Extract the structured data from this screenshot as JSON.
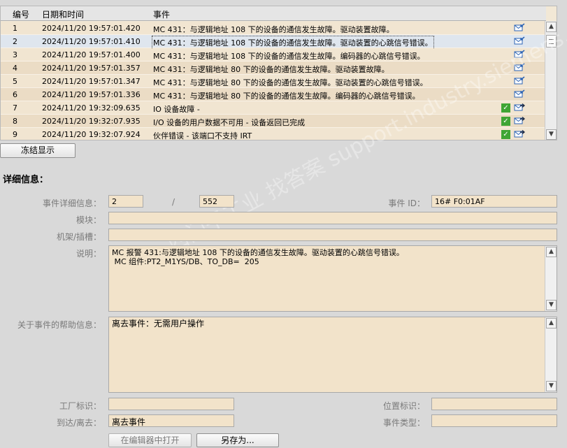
{
  "event_table": {
    "headers": {
      "no": "编号",
      "datetime": "日期和时间",
      "event": "事件"
    },
    "rows": [
      {
        "no": "1",
        "datetime": "2024/11/20 19:57:01.420",
        "event": "MC 431：与逻辑地址 108 下的设备的通信发生故障。驱动装置故障。",
        "ack": false,
        "icon": "incoming-mail-icon"
      },
      {
        "no": "2",
        "datetime": "2024/11/20 19:57:01.410",
        "event": "MC 431：与逻辑地址 108 下的设备的通信发生故障。驱动装置的心跳信号错误。",
        "ack": false,
        "icon": "incoming-mail-icon",
        "selected": true
      },
      {
        "no": "3",
        "datetime": "2024/11/20 19:57:01.400",
        "event": "MC 431：与逻辑地址 108 下的设备的通信发生故障。编码器的心跳信号错误。",
        "ack": false,
        "icon": "incoming-mail-icon"
      },
      {
        "no": "4",
        "datetime": "2024/11/20 19:57:01.357",
        "event": "MC 431：与逻辑地址 80 下的设备的通信发生故障。驱动装置故障。",
        "ack": false,
        "icon": "incoming-mail-icon"
      },
      {
        "no": "5",
        "datetime": "2024/11/20 19:57:01.347",
        "event": "MC 431：与逻辑地址 80 下的设备的通信发生故障。驱动装置的心跳信号错误。",
        "ack": false,
        "icon": "incoming-mail-icon"
      },
      {
        "no": "6",
        "datetime": "2024/11/20 19:57:01.336",
        "event": "MC 431：与逻辑地址 80 下的设备的通信发生故障。编码器的心跳信号错误。",
        "ack": false,
        "icon": "incoming-mail-icon"
      },
      {
        "no": "7",
        "datetime": "2024/11/20 19:32:09.635",
        "event": "IO 设备故障 -",
        "ack": true,
        "icon": "outgoing-mail-icon"
      },
      {
        "no": "8",
        "datetime": "2024/11/20 19:32:07.935",
        "event": "I/O 设备的用户数据不可用 - 设备返回已完成",
        "ack": true,
        "icon": "outgoing-mail-icon"
      },
      {
        "no": "9",
        "datetime": "2024/11/20 19:32:07.924",
        "event": "伙伴错误  - 该端口不支持 IRT",
        "ack": true,
        "icon": "outgoing-mail-icon"
      }
    ]
  },
  "freeze_button": "冻结显示",
  "details": {
    "title": "详细信息：",
    "event_detail_label": "事件详细信息：",
    "event_detail_index": "2",
    "separator": "/",
    "event_detail_total": "552",
    "event_id_label": "事件 ID：",
    "event_id_value": "16# F0:01AF",
    "module_label": "模块：",
    "module_value": "",
    "rack_slot_label": "机架/插槽：",
    "rack_slot_value": "",
    "description_label": "说明：",
    "description_value": "MC 报警 431:与逻辑地址 108 下的设备的通信发生故障。驱动装置的心跳信号错误。\n MC 组件:PT2_M1YS/DB、TO_DB=  205",
    "help_label": "关于事件的帮助信息：",
    "help_value": "离去事件：无需用户操作",
    "plant_id_label": "工厂标识：",
    "plant_id_value": "",
    "location_id_label": "位置标识：",
    "location_id_value": "",
    "incoming_outgoing_label": "到达/离去：",
    "incoming_outgoing_value": "离去事件",
    "event_type_label": "事件类型：",
    "event_type_value": "",
    "open_in_editor_button": "在编辑器中打开",
    "save_as_button": "另存为..."
  },
  "watermark": "西门子工业 找答案 support.industry.siemens.com/cs",
  "colors": {
    "background": "#d9d9d9",
    "field": "#f2e3ca",
    "row_selected": "#dfe6ee",
    "check": "#3fa535",
    "mail": "#2b63b5"
  }
}
